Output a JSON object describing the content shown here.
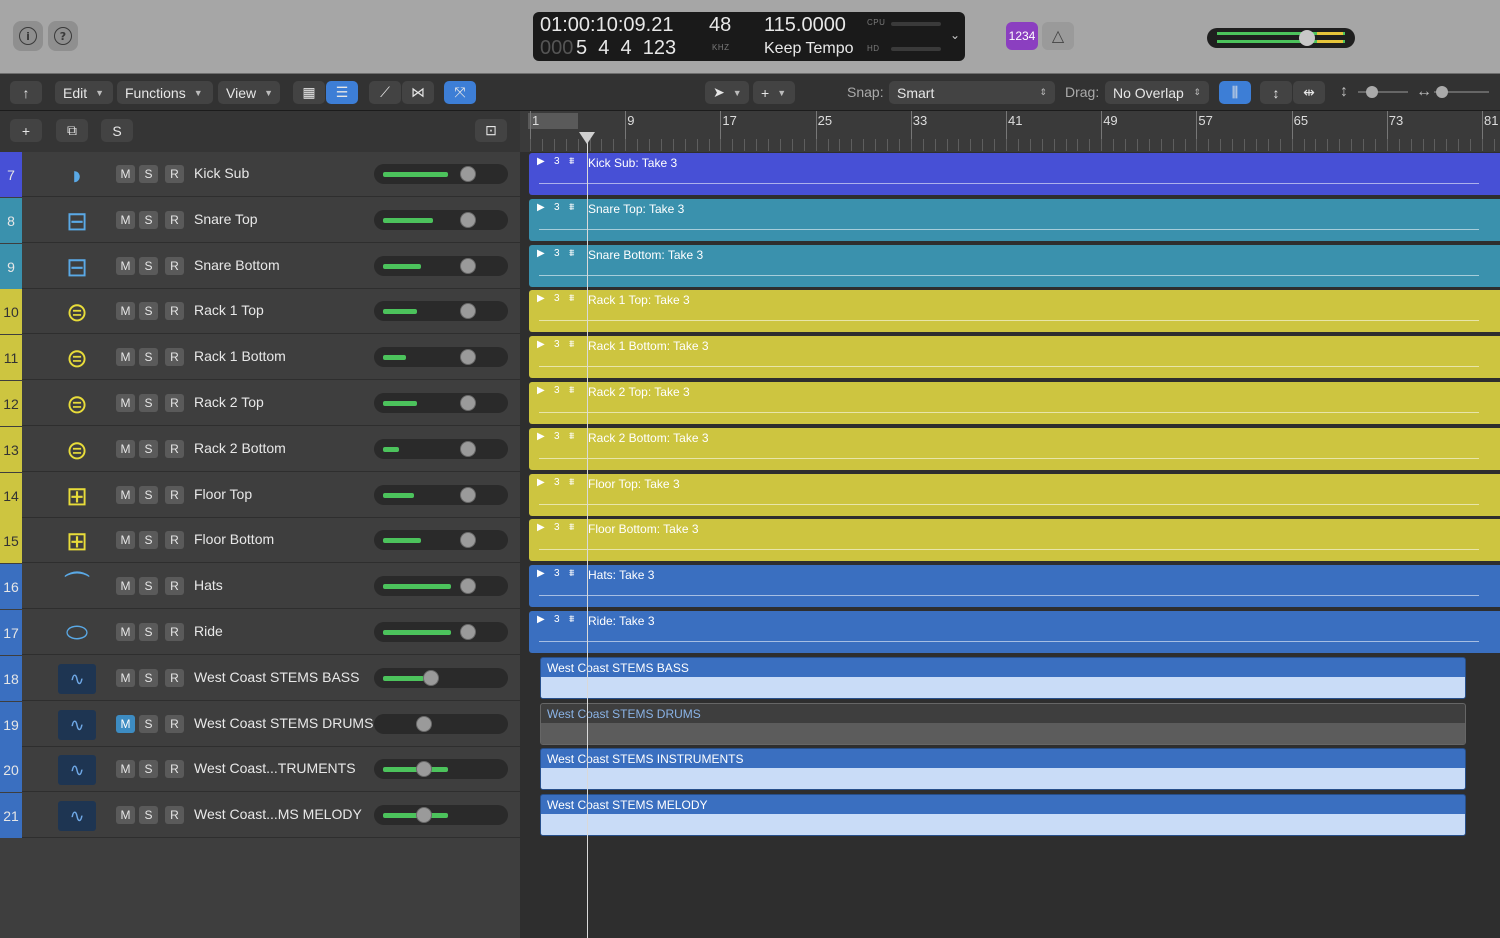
{
  "transport": {
    "time": "01:00:10:09.21",
    "bars_dim": "000",
    "bars": "5  4  4  123",
    "sample_rate": "48",
    "sample_rate_unit": "KHZ",
    "tempo": "115.0000",
    "tempo_mode": "Keep Tempo",
    "cpu_label": "CPU",
    "hd_label": "HD",
    "count_in": "1234"
  },
  "toolbar": {
    "edit": "Edit",
    "functions": "Functions",
    "view": "View",
    "snap_label": "Snap:",
    "snap_value": "Smart",
    "drag_label": "Drag:",
    "drag_value": "No Overlap"
  },
  "track_header": {
    "s_button": "S"
  },
  "ruler": {
    "bars": [
      "1",
      "9",
      "17",
      "25",
      "33",
      "41",
      "49",
      "57",
      "65",
      "73",
      "81"
    ]
  },
  "colors": {
    "purple": "#4750d6",
    "teal": "#3a91ad",
    "yellow": "#cdc540",
    "blue": "#3a6fc0",
    "stem_light": "#c9dcf7",
    "stem_dim": "#5c5c5c"
  },
  "tracks": [
    {
      "num": "7",
      "name": "Kick Sub",
      "icon": "kick-drum-icon",
      "color": "#4750d6",
      "level": 0.72,
      "mute": false,
      "region": "Kick Sub: Take 3",
      "take": "3"
    },
    {
      "num": "8",
      "name": "Snare Top",
      "icon": "snare-drum-icon",
      "color": "#3a91ad",
      "level": 0.55,
      "mute": false,
      "region": "Snare Top: Take 3",
      "take": "3"
    },
    {
      "num": "9",
      "name": "Snare Bottom",
      "icon": "snare-drum-icon",
      "color": "#3a91ad",
      "level": 0.42,
      "mute": false,
      "region": "Snare Bottom: Take 3",
      "take": "3"
    },
    {
      "num": "10",
      "name": "Rack 1 Top",
      "icon": "tom-drum-icon",
      "color": "#cdc540",
      "level": 0.38,
      "mute": false,
      "region": "Rack 1 Top: Take 3",
      "take": "3"
    },
    {
      "num": "11",
      "name": "Rack 1 Bottom",
      "icon": "tom-drum-icon",
      "color": "#cdc540",
      "level": 0.25,
      "mute": false,
      "region": "Rack 1 Bottom: Take 3",
      "take": "3"
    },
    {
      "num": "12",
      "name": "Rack 2 Top",
      "icon": "tom-drum-icon",
      "color": "#cdc540",
      "level": 0.38,
      "mute": false,
      "region": "Rack 2 Top: Take 3",
      "take": "3"
    },
    {
      "num": "13",
      "name": "Rack 2 Bottom",
      "icon": "tom-drum-icon",
      "color": "#cdc540",
      "level": 0.18,
      "mute": false,
      "region": "Rack 2 Bottom: Take 3",
      "take": "3"
    },
    {
      "num": "14",
      "name": "Floor Top",
      "icon": "floor-tom-icon",
      "color": "#cdc540",
      "level": 0.35,
      "mute": false,
      "region": "Floor Top: Take 3",
      "take": "3"
    },
    {
      "num": "15",
      "name": "Floor Bottom",
      "icon": "floor-tom-icon",
      "color": "#cdc540",
      "level": 0.42,
      "mute": false,
      "region": "Floor Bottom: Take 3",
      "take": "3"
    },
    {
      "num": "16",
      "name": "Hats",
      "icon": "hi-hat-icon",
      "color": "#3a6fc0",
      "level": 0.75,
      "mute": false,
      "region": "Hats: Take 3",
      "take": "3"
    },
    {
      "num": "17",
      "name": "Ride",
      "icon": "ride-cymbal-icon",
      "color": "#3a6fc0",
      "level": 0.75,
      "mute": false,
      "region": "Ride: Take 3",
      "take": "3"
    },
    {
      "num": "18",
      "name": "West Coast STEMS BASS",
      "icon": "audio-waveform-icon",
      "color": "#3a6fc0",
      "level": 0.45,
      "mute": false,
      "region": "West Coast STEMS BASS",
      "take": ""
    },
    {
      "num": "19",
      "name": "West Coast STEMS DRUMS",
      "icon": "audio-waveform-icon",
      "color": "#3a6fc0",
      "level": 0.0,
      "mute": true,
      "region": "West Coast STEMS DRUMS",
      "take": ""
    },
    {
      "num": "20",
      "name": "West Coast...TRUMENTS",
      "icon": "audio-waveform-icon",
      "color": "#3a6fc0",
      "level": 0.72,
      "mute": false,
      "region": "West Coast STEMS INSTRUMENTS",
      "take": ""
    },
    {
      "num": "21",
      "name": "West Coast...MS MELODY",
      "icon": "audio-waveform-icon",
      "color": "#3a6fc0",
      "level": 0.72,
      "mute": false,
      "region": "West Coast STEMS MELODY",
      "take": ""
    }
  ],
  "msr": {
    "m": "M",
    "s": "S",
    "r": "R"
  }
}
